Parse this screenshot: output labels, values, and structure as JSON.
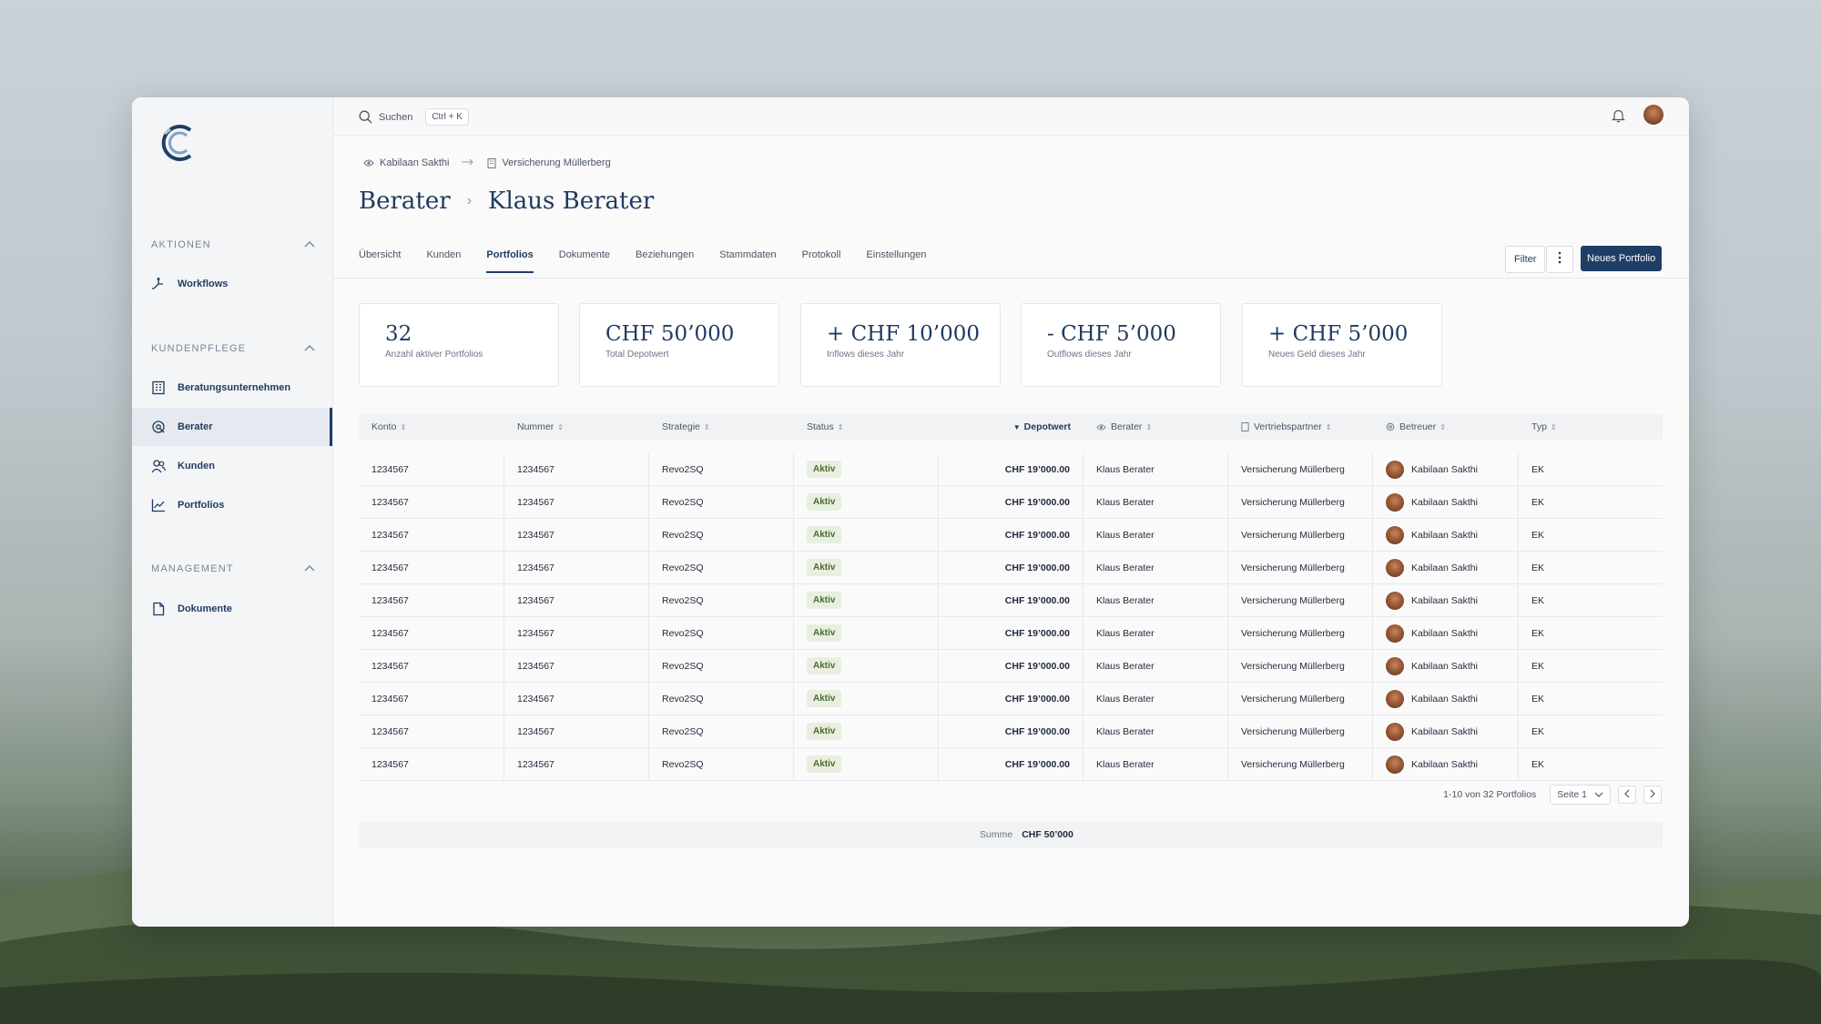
{
  "search": {
    "label": "Suchen",
    "shortcut": "Ctrl + K"
  },
  "sidebar": {
    "sections": [
      {
        "title": "AKTIONEN",
        "items": [
          {
            "label": "Workflows",
            "icon": "workflow-icon"
          }
        ]
      },
      {
        "title": "KUNDENPFLEGE",
        "items": [
          {
            "label": "Beratungsunternehmen",
            "icon": "building-icon"
          },
          {
            "label": "Berater",
            "icon": "advisor-icon",
            "active": true
          },
          {
            "label": "Kunden",
            "icon": "users-icon"
          },
          {
            "label": "Portfolios",
            "icon": "chart-line-icon"
          }
        ]
      },
      {
        "title": "MANAGEMENT",
        "items": [
          {
            "label": "Dokumente",
            "icon": "document-icon"
          }
        ]
      }
    ]
  },
  "breadcrumb": {
    "first": "Kabilaan Sakthi",
    "second": "Versicherung Müllerberg"
  },
  "page_title": {
    "parent": "Berater",
    "current": "Klaus Berater"
  },
  "tabs": [
    "Übersicht",
    "Kunden",
    "Portfolios",
    "Dokumente",
    "Beziehungen",
    "Stammdaten",
    "Protokoll",
    "Einstellungen"
  ],
  "active_tab": "Portfolios",
  "actions": {
    "filter": "Filter",
    "new_portfolio": "Neues Portfolio"
  },
  "stats": [
    {
      "value": "32",
      "label": "Anzahl aktiver Portfolios"
    },
    {
      "value": "CHF 50’000",
      "label": "Total Depotwert"
    },
    {
      "value": "+ CHF 10’000",
      "label": "Inflows dieses Jahr"
    },
    {
      "value": "- CHF 5’000",
      "label": "Outflows dieses Jahr"
    },
    {
      "value": "+ CHF 5’000",
      "label": "Neues Geld dieses Jahr"
    }
  ],
  "table": {
    "columns": [
      "Konto",
      "Nummer",
      "Strategie",
      "Status",
      "Depotwert",
      "Berater",
      "Vertriebspartner",
      "Betreuer",
      "Typ"
    ],
    "rows": [
      [
        "1234567",
        "1234567",
        "Revo2SQ",
        "Aktiv",
        "CHF 19’000.00",
        "Klaus Berater",
        "Versicherung Müllerberg",
        "Kabilaan Sakthi",
        "EK"
      ],
      [
        "1234567",
        "1234567",
        "Revo2SQ",
        "Aktiv",
        "CHF 19’000.00",
        "Klaus Berater",
        "Versicherung Müllerberg",
        "Kabilaan Sakthi",
        "EK"
      ],
      [
        "1234567",
        "1234567",
        "Revo2SQ",
        "Aktiv",
        "CHF 19’000.00",
        "Klaus Berater",
        "Versicherung Müllerberg",
        "Kabilaan Sakthi",
        "EK"
      ],
      [
        "1234567",
        "1234567",
        "Revo2SQ",
        "Aktiv",
        "CHF 19’000.00",
        "Klaus Berater",
        "Versicherung Müllerberg",
        "Kabilaan Sakthi",
        "EK"
      ],
      [
        "1234567",
        "1234567",
        "Revo2SQ",
        "Aktiv",
        "CHF 19’000.00",
        "Klaus Berater",
        "Versicherung Müllerberg",
        "Kabilaan Sakthi",
        "EK"
      ],
      [
        "1234567",
        "1234567",
        "Revo2SQ",
        "Aktiv",
        "CHF 19’000.00",
        "Klaus Berater",
        "Versicherung Müllerberg",
        "Kabilaan Sakthi",
        "EK"
      ],
      [
        "1234567",
        "1234567",
        "Revo2SQ",
        "Aktiv",
        "CHF 19’000.00",
        "Klaus Berater",
        "Versicherung Müllerberg",
        "Kabilaan Sakthi",
        "EK"
      ],
      [
        "1234567",
        "1234567",
        "Revo2SQ",
        "Aktiv",
        "CHF 19’000.00",
        "Klaus Berater",
        "Versicherung Müllerberg",
        "Kabilaan Sakthi",
        "EK"
      ],
      [
        "1234567",
        "1234567",
        "Revo2SQ",
        "Aktiv",
        "CHF 19’000.00",
        "Klaus Berater",
        "Versicherung Müllerberg",
        "Kabilaan Sakthi",
        "EK"
      ],
      [
        "1234567",
        "1234567",
        "Revo2SQ",
        "Aktiv",
        "CHF 19’000.00",
        "Klaus Berater",
        "Versicherung Müllerberg",
        "Kabilaan Sakthi",
        "EK"
      ]
    ]
  },
  "pagination": {
    "summary": "1-10 von 32 Portfolios",
    "page": "Seite 1"
  },
  "sum": {
    "label": "Summe",
    "value": "CHF 50’000"
  },
  "colors": {
    "primary": "#1f3e66",
    "active_badge_bg": "#e8efe0",
    "active_badge_text": "#4b6b2a"
  }
}
